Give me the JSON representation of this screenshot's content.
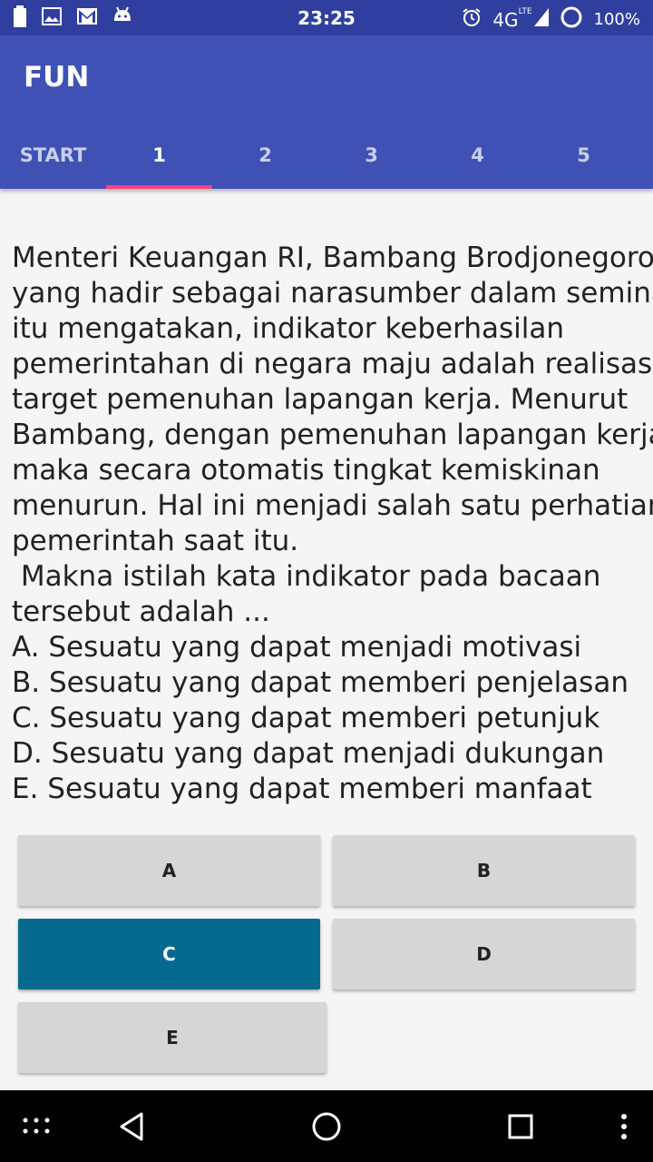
{
  "status_bar": {
    "time": "23:25",
    "network": "4G",
    "network_sub": "LTE",
    "battery": "100%",
    "left_icons": [
      "battery-full-icon",
      "image-icon",
      "gmail-icon",
      "android-icon"
    ],
    "right_icons": [
      "alarm-icon",
      "signal-icon",
      "circle-icon"
    ]
  },
  "app_bar": {
    "title": "FUN",
    "tabs": [
      {
        "label": "START"
      },
      {
        "label": "1"
      },
      {
        "label": "2"
      },
      {
        "label": "3"
      },
      {
        "label": "4"
      },
      {
        "label": "5"
      }
    ],
    "active_tab": "1",
    "color": "#3F51B5",
    "indicator_color": "#FF4081"
  },
  "question": {
    "lines": [
      "Menteri Keuangan RI, Bambang Brodjonegoro",
      "yang hadir sebagai narasumber dalam seminar",
      "itu mengatakan, indikator keberhasilan",
      "pemerintahan di negara maju adalah realisasi",
      "target pemenuhan lapangan kerja. Menurut",
      "Bambang, dengan pemenuhan lapangan kerja",
      "maka secara otomatis tingkat kemiskinan",
      "menurun. Hal ini menjadi salah satu perhatian",
      "pemerintah saat itu.",
      " Makna istilah kata indikator pada bacaan",
      "tersebut adalah ...",
      "A. Sesuatu yang dapat menjadi motivasi",
      "B. Sesuatu yang dapat memberi penjelasan",
      "C. Sesuatu yang dapat memberi petunjuk",
      "D. Sesuatu yang dapat menjadi dukungan",
      "E. Sesuatu yang dapat memberi manfaat"
    ]
  },
  "answers": {
    "a": "A",
    "b": "B",
    "c": "C",
    "d": "D",
    "e": "E",
    "selected": "C",
    "selected_color": "#06698F"
  },
  "nav_bar": {
    "icons": [
      "apps-grid-icon",
      "back-icon",
      "home-icon",
      "recents-icon",
      "more-icon"
    ]
  }
}
